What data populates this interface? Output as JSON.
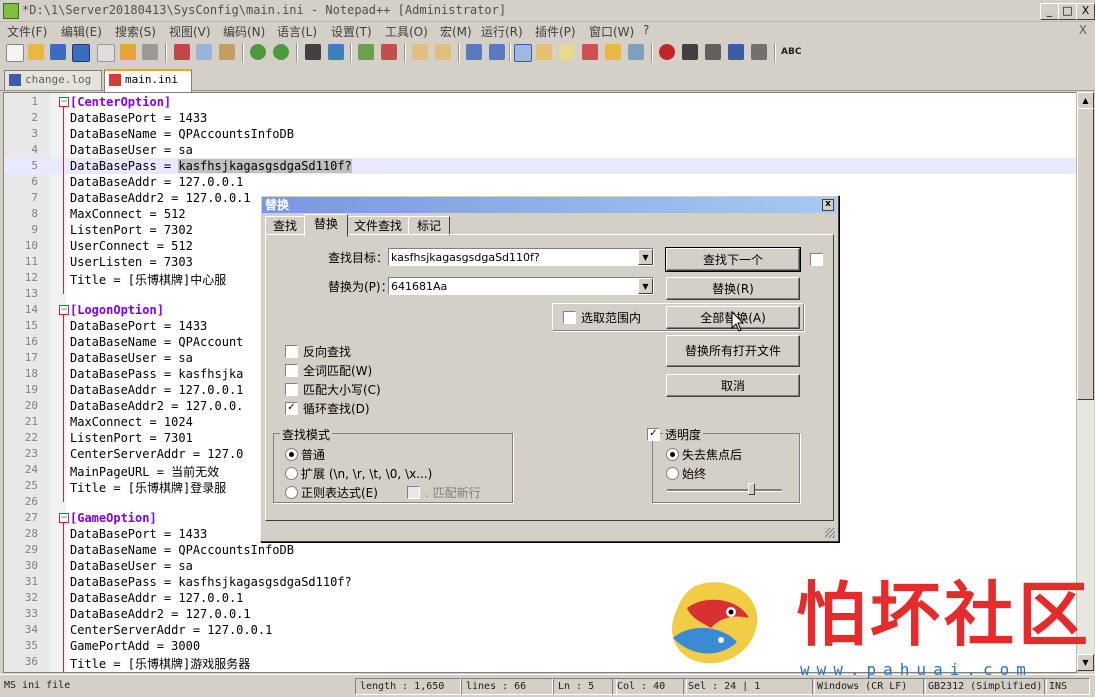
{
  "window": {
    "title": "*D:\\1\\Server20180413\\SysConfig\\main.ini - Notepad++ [Administrator]",
    "min_label": "_",
    "max_label": "□",
    "close_label": "X"
  },
  "menu": {
    "items": [
      "文件(F)",
      "编辑(E)",
      "搜索(S)",
      "视图(V)",
      "编码(N)",
      "语言(L)",
      "设置(T)",
      "工具(O)",
      "宏(M)",
      "运行(R)",
      "插件(P)",
      "窗口(W)",
      "?"
    ],
    "close_label": "X"
  },
  "toolbar": {
    "icons": [
      "new-file-icon",
      "open-file-icon",
      "save-icon",
      "save-all-icon",
      "close-icon",
      "close-all-icon",
      "print-icon",
      "cut-icon",
      "copy-icon",
      "paste-icon",
      "undo-icon",
      "redo-icon",
      "find-icon",
      "replace-icon",
      "zoom-in-icon",
      "zoom-out-icon",
      "sync-v-icon",
      "sync-h-icon",
      "wrap-icon",
      "all-chars-icon",
      "indent-guide-icon",
      "user-lang-icon",
      "doc-map-icon",
      "function-list-icon",
      "folder-workspace-icon",
      "monitor-icon",
      "record-macro-icon",
      "stop-macro-icon",
      "play-macro-icon",
      "run-macro-icon",
      "save-macro-icon",
      "spellcheck-icon"
    ],
    "spellcheck_label": "ABC"
  },
  "tabs": [
    {
      "label": "change.log",
      "active": false
    },
    {
      "label": "main.ini",
      "active": true
    }
  ],
  "editor": {
    "lines": [
      {
        "n": "1",
        "text": "[CenterOption]",
        "section": true
      },
      {
        "n": "2",
        "text": "DataBasePort = 1433"
      },
      {
        "n": "3",
        "text": "DataBaseName = QPAccountsInfoDB"
      },
      {
        "n": "4",
        "text": "DataBaseUser = sa"
      },
      {
        "n": "5",
        "text": "DataBasePass = ",
        "sel": "kasfhsjkagasgsdgaSd110f?",
        "current": true
      },
      {
        "n": "6",
        "text": "DataBaseAddr = 127.0.0.1"
      },
      {
        "n": "7",
        "text": "DataBaseAddr2 = 127.0.0.1"
      },
      {
        "n": "8",
        "text": "MaxConnect = 512"
      },
      {
        "n": "9",
        "text": "ListenPort = 7302"
      },
      {
        "n": "10",
        "text": "UserConnect = 512"
      },
      {
        "n": "11",
        "text": "UserListen = 7303"
      },
      {
        "n": "12",
        "text": "Title = [乐博棋牌]中心服"
      },
      {
        "n": "13",
        "text": ""
      },
      {
        "n": "14",
        "text": "[LogonOption]",
        "section": true
      },
      {
        "n": "15",
        "text": "DataBasePort = 1433"
      },
      {
        "n": "16",
        "text": "DataBaseName = QPAccount"
      },
      {
        "n": "17",
        "text": "DataBaseUser = sa"
      },
      {
        "n": "18",
        "text": "DataBasePass = kasfhsjka"
      },
      {
        "n": "19",
        "text": "DataBaseAddr = 127.0.0.1"
      },
      {
        "n": "20",
        "text": "DataBaseAddr2 = 127.0.0."
      },
      {
        "n": "21",
        "text": "MaxConnect = 1024"
      },
      {
        "n": "22",
        "text": "ListenPort = 7301"
      },
      {
        "n": "23",
        "text": "CenterServerAddr = 127.0"
      },
      {
        "n": "24",
        "text": "MainPageURL = 当前无效"
      },
      {
        "n": "25",
        "text": "Title = [乐博棋牌]登录服"
      },
      {
        "n": "26",
        "text": ""
      },
      {
        "n": "27",
        "text": "[GameOption]",
        "section": true
      },
      {
        "n": "28",
        "text": "DataBasePort = 1433"
      },
      {
        "n": "29",
        "text": "DataBaseName = QPAccountsInfoDB"
      },
      {
        "n": "30",
        "text": "DataBaseUser = sa"
      },
      {
        "n": "31",
        "text": "DataBasePass = kasfhsjkagasgsdgaSd110f?"
      },
      {
        "n": "32",
        "text": "DataBaseAddr = 127.0.0.1"
      },
      {
        "n": "33",
        "text": "DataBaseAddr2 = 127.0.0.1"
      },
      {
        "n": "34",
        "text": "CenterServerAddr = 127.0.0.1"
      },
      {
        "n": "35",
        "text": "GamePortAdd = 3000"
      },
      {
        "n": "36",
        "text": "Title = [乐博棋牌]游戏服务器"
      }
    ]
  },
  "dialog": {
    "title": "替换",
    "close_label": "x",
    "tabs": [
      "查找",
      "替换",
      "文件查找",
      "标记"
    ],
    "active_tab": "替换",
    "find_label": "查找目标：",
    "find_value": "kasfhsjkagasgsdgaSd110f?",
    "replace_label": "替换为(P)：",
    "replace_value": "641681Aa",
    "in_selection_label": "选取范围内",
    "buttons": {
      "find_next": "查找下一个",
      "replace": "替换(R)",
      "replace_all": "全部替换(A)",
      "replace_all_open": "替换所有打开文件",
      "cancel": "取消"
    },
    "options": [
      {
        "label": "反向查找",
        "checked": false
      },
      {
        "label": "全词匹配(W)",
        "checked": false
      },
      {
        "label": "匹配大小写(C)",
        "checked": false
      },
      {
        "label": "循环查找(D)",
        "checked": true
      }
    ],
    "search_mode": {
      "title": "查找模式",
      "normal": "普通",
      "extended": "扩展 (\\n, \\r, \\t, \\0, \\x...)",
      "regex": "正则表达式(E)",
      "dot_newline": ". 匹配新行",
      "selected": "普通"
    },
    "transparency": {
      "title": "透明度",
      "enabled": true,
      "on_lose_focus": "失去焦点后",
      "always": "始终",
      "selected": "失去焦点后"
    },
    "check_mark": "✓"
  },
  "statusbar": {
    "filetype": "MS ini file",
    "length": "length : 1,650",
    "lines": "lines : 66",
    "ln": "Ln : 5",
    "col": "Col : 40",
    "sel": "Sel : 24 | 1",
    "eol": "Windows (CR LF)",
    "encoding": "GB2312 (Simplified)",
    "mode": "INS"
  },
  "watermark": {
    "text": "怕坏社区",
    "url": "www.pahuai.com"
  }
}
